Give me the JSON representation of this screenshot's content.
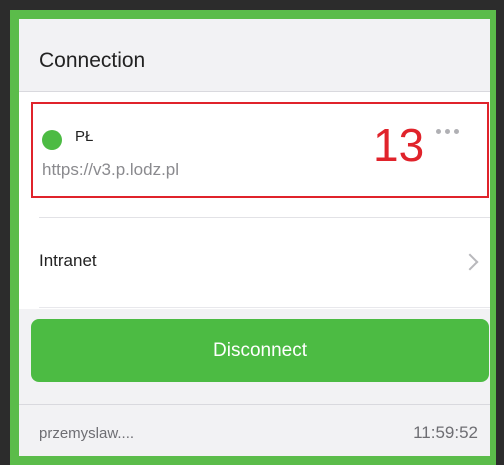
{
  "header": {
    "title": "Connection"
  },
  "server": {
    "name": "PŁ",
    "url": "https://v3.p.lodz.pl",
    "status_color": "#4cbb43",
    "annotation": "13",
    "more_icon": "more-horizontal-icon"
  },
  "intranet": {
    "label": "Intranet",
    "icon": "chevron-right-icon"
  },
  "actions": {
    "disconnect_label": "Disconnect"
  },
  "footer": {
    "user": "przemyslaw....",
    "time": "11:59:52"
  },
  "colors": {
    "accent": "#4cbb43",
    "highlight_border": "#e0232b",
    "background": "#f2f2f4"
  }
}
